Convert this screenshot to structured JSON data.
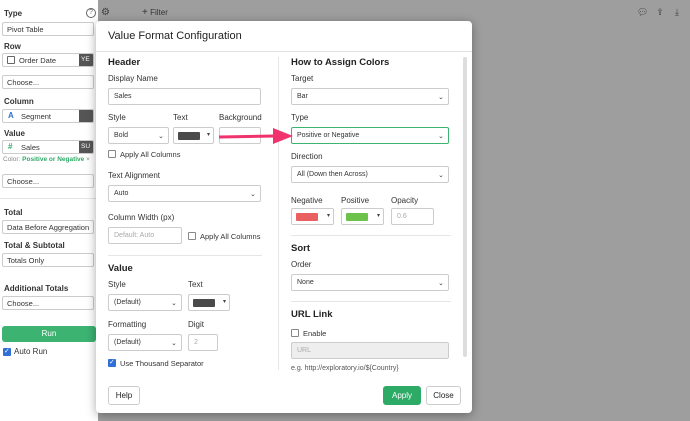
{
  "left_panel": {
    "type_label": "Type",
    "type_value": "Pivot Table",
    "row_label": "Row",
    "row_field": "Order Date",
    "row_tag": "YE",
    "row_choose": "Choose...",
    "column_label": "Column",
    "column_field": "Segment",
    "column_field_icon": "A",
    "value_label": "Value",
    "value_field": "Sales",
    "value_field_icon": "#",
    "value_tag": "SU",
    "color_prefix": "Color:",
    "color_value": "Positive or Negative",
    "value_choose": "Choose...",
    "total_label": "Total",
    "total_value": "Data Before Aggregation",
    "total_subtotal_label": "Total & Subtotal",
    "total_subtotal_value": "Totals Only",
    "additional_totals_label": "Additional Totals",
    "additional_totals_value": "Choose...",
    "run_label": "Run",
    "auto_run_label": "Auto Run",
    "auto_run_checked": true
  },
  "topbar": {
    "filter_label": "Filter",
    "icons": [
      "comment-icon",
      "share-icon",
      "download-icon"
    ]
  },
  "dialog": {
    "title": "Value Format Configuration",
    "header_section": {
      "heading": "Header",
      "display_name_label": "Display Name",
      "display_name_value": "Sales",
      "style_label": "Style",
      "style_value": "Bold",
      "text_label": "Text",
      "text_color": "#4a4a4a",
      "background_label": "Background",
      "apply_all_columns_label": "Apply All Columns",
      "text_alignment_label": "Text Alignment",
      "text_alignment_value": "Auto",
      "column_width_label": "Column Width (px)",
      "column_width_placeholder": "Default: Auto",
      "column_width_apply_label": "Apply All Columns"
    },
    "value_section": {
      "heading": "Value",
      "style_label": "Style",
      "style_value": "(Default)",
      "text_label": "Text",
      "text_color": "#4a4a4a",
      "formatting_label": "Formatting",
      "formatting_value": "(Default)",
      "digit_label": "Digit",
      "digit_placeholder": "2",
      "thousand_sep_label": "Use Thousand Separator",
      "thousand_sep_checked": true
    },
    "colors_section": {
      "heading": "How to Assign Colors",
      "target_label": "Target",
      "target_value": "Bar",
      "type_label": "Type",
      "type_value": "Positive or Negative",
      "direction_label": "Direction",
      "direction_value": "All (Down then Across)",
      "negative_label": "Negative",
      "negative_color": "#e86060",
      "positive_label": "Positive",
      "positive_color": "#6cc24a",
      "opacity_label": "Opacity",
      "opacity_placeholder": "0.6"
    },
    "sort_section": {
      "heading": "Sort",
      "order_label": "Order",
      "order_value": "None"
    },
    "url_section": {
      "heading": "URL Link",
      "enable_label": "Enable",
      "url_placeholder": "URL",
      "example": "e.g. http://exploratory.io/${Country}"
    },
    "buttons": {
      "help": "Help",
      "apply": "Apply",
      "close": "Close"
    }
  },
  "accent_colors": {
    "green": "#2eaa67",
    "arrow": "#f0336c"
  }
}
